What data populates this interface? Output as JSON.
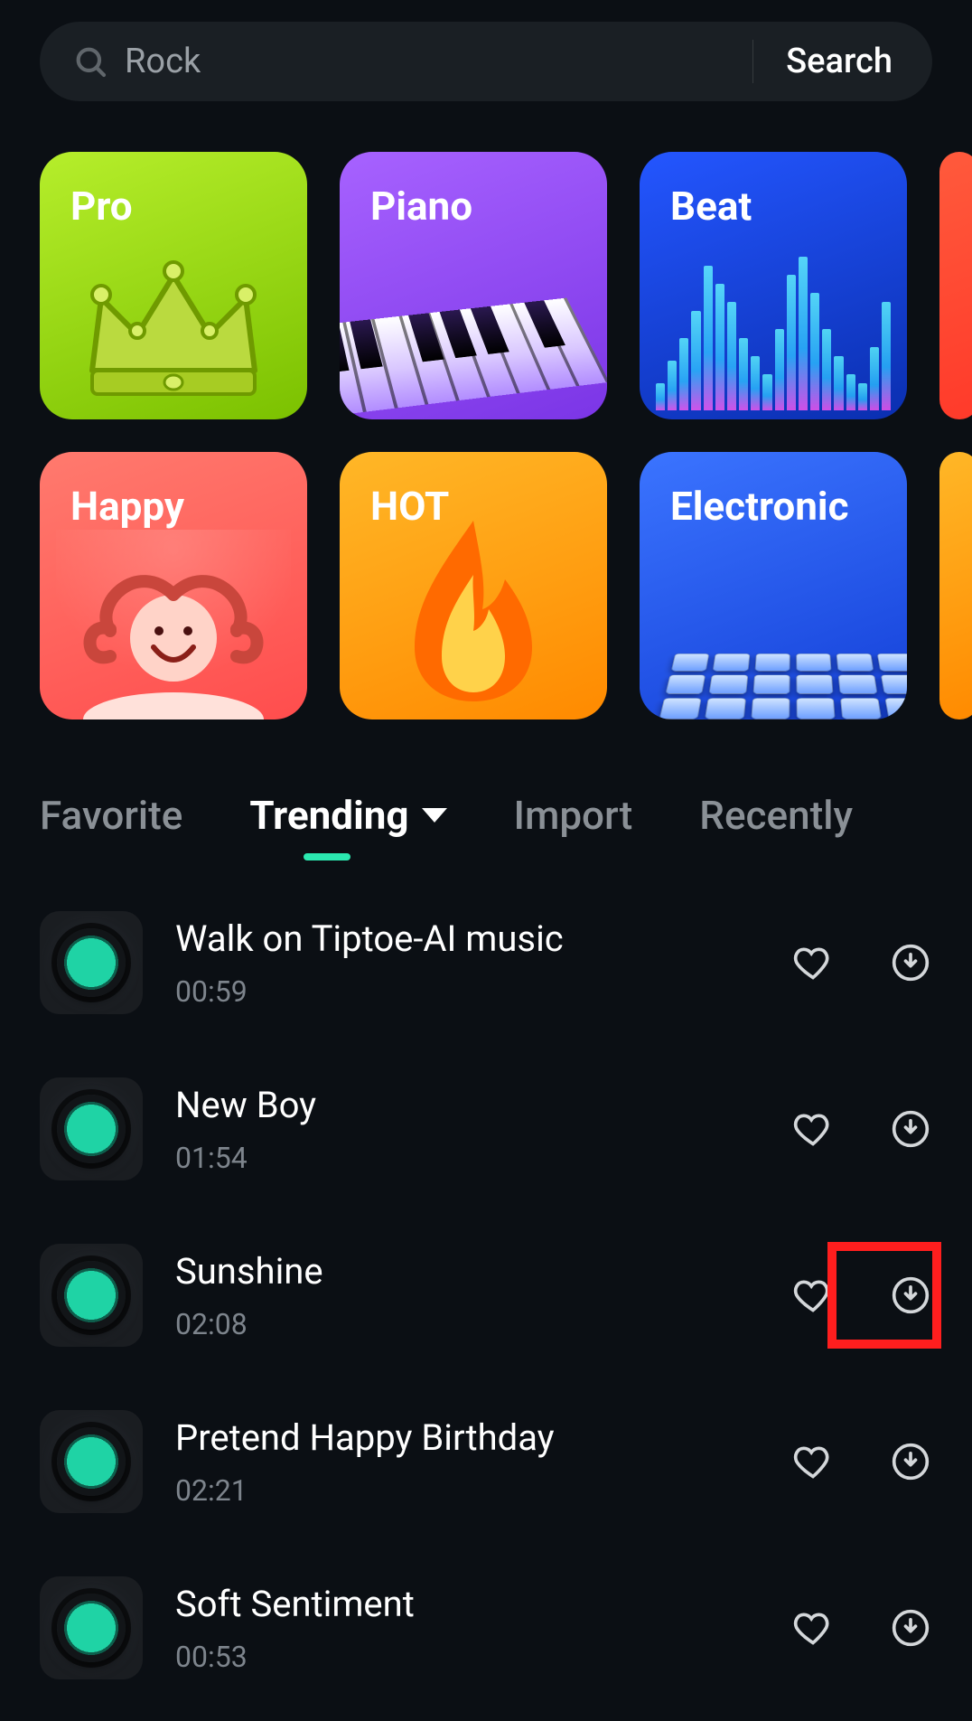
{
  "search": {
    "placeholder": "Rock",
    "button_label": "Search"
  },
  "categories": [
    [
      {
        "key": "pro",
        "label": "Pro",
        "tile_class": "tile-pro",
        "art": "crown"
      },
      {
        "key": "piano",
        "label": "Piano",
        "tile_class": "tile-piano",
        "art": "piano"
      },
      {
        "key": "beat",
        "label": "Beat",
        "tile_class": "tile-beat",
        "art": "beat"
      },
      {
        "key": "edge1",
        "label": "",
        "tile_class": "tile-edge-red",
        "art": "none",
        "peek": true
      }
    ],
    [
      {
        "key": "happy",
        "label": "Happy",
        "tile_class": "tile-happy",
        "art": "happy"
      },
      {
        "key": "hot",
        "label": "HOT",
        "tile_class": "tile-hot",
        "art": "flame"
      },
      {
        "key": "electronic",
        "label": "Electronic",
        "tile_class": "tile-electronic",
        "art": "pad"
      },
      {
        "key": "edge2",
        "label": "",
        "tile_class": "tile-edge-orange",
        "art": "none",
        "peek": true
      }
    ]
  ],
  "tabs": [
    {
      "key": "favorite",
      "label": "Favorite",
      "active": false
    },
    {
      "key": "trending",
      "label": "Trending",
      "active": true,
      "dropdown": true
    },
    {
      "key": "import",
      "label": "Import",
      "active": false
    },
    {
      "key": "recently",
      "label": "Recently",
      "active": false
    }
  ],
  "tracks": [
    {
      "title": "Walk on Tiptoe-AI music",
      "duration": "00:59",
      "highlighted": false
    },
    {
      "title": "New Boy",
      "duration": "01:54",
      "highlighted": false
    },
    {
      "title": "Sunshine",
      "duration": "02:08",
      "highlighted": true
    },
    {
      "title": "Pretend Happy Birthday",
      "duration": "02:21",
      "highlighted": false
    },
    {
      "title": "Soft Sentiment",
      "duration": "00:53",
      "highlighted": false
    }
  ],
  "beat_bar_heights": [
    30,
    55,
    80,
    110,
    160,
    140,
    120,
    80,
    60,
    40,
    90,
    150,
    170,
    130,
    90,
    60,
    40,
    30,
    70,
    120
  ],
  "colors": {
    "accent": "#2be8b0",
    "highlight_border": "#ff1e1e"
  }
}
